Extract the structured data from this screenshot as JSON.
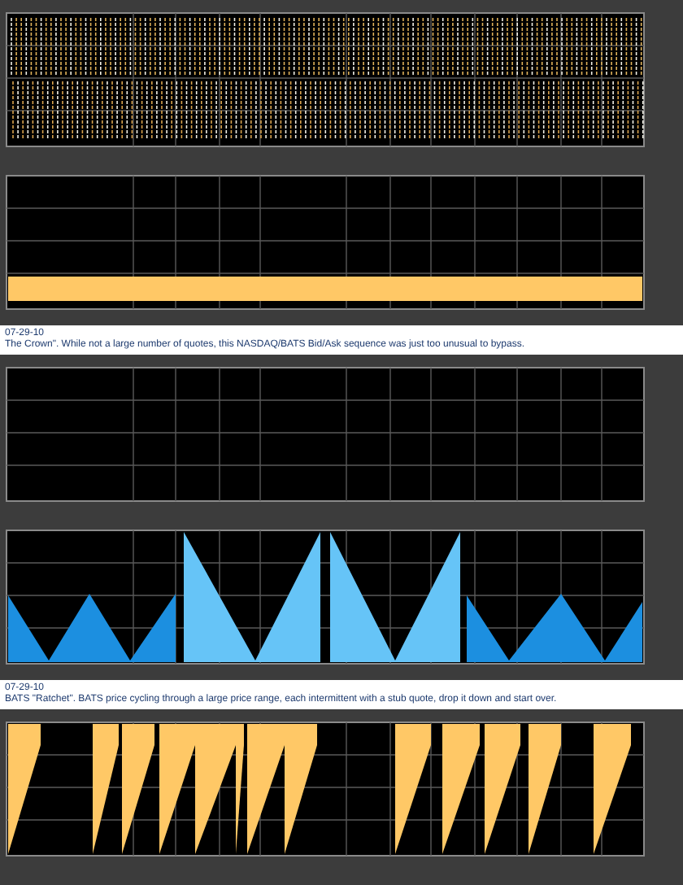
{
  "panels": [
    {
      "kind": "spike-chart"
    },
    {
      "kind": "bar-chart"
    },
    {
      "kind": "note",
      "date": "07-29-10",
      "text": "The Crown\". While not a large number of quotes, this NASDAQ/BATS Bid/Ask sequence was just too unusual to bypass."
    },
    {
      "kind": "empty-chart"
    },
    {
      "kind": "triangle-chart"
    },
    {
      "kind": "note",
      "date": "07-29-10",
      "text": "BATS \"Ratchet\". BATS price cycling through a large price range, each intermittent with a stub quote, drop it down and start over."
    },
    {
      "kind": "sawtooth-chart"
    }
  ]
}
